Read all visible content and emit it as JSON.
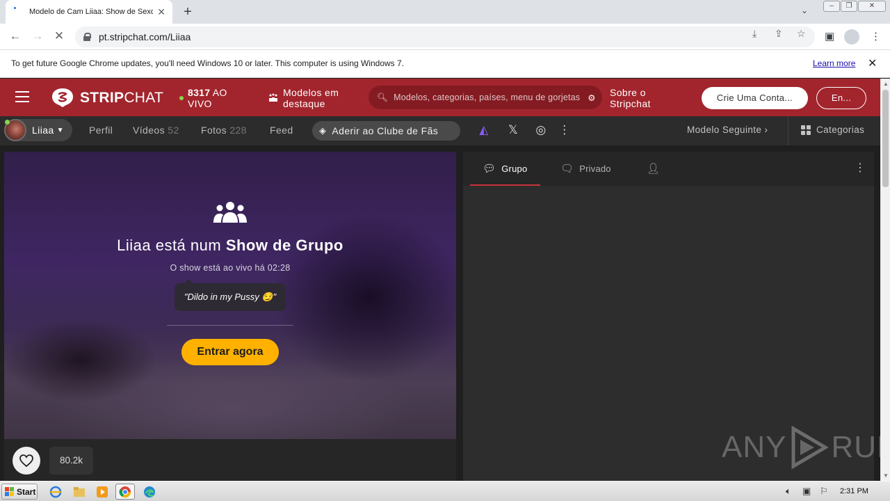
{
  "browser": {
    "tab_title": "Modelo de Cam Liiaa: Show de Sexo",
    "new_tab_label": "+",
    "url": "pt.stripchat.com/Liiaa",
    "infobar": {
      "message": "To get future Google Chrome updates, you'll need Windows 10 or later. This computer is using Windows 7.",
      "link": "Learn more"
    }
  },
  "header": {
    "logo_bold": "STRIP",
    "logo_rest": "CHAT",
    "live_count": "8317",
    "live_label": "AO VIVO",
    "featured_line1": "Modelos em",
    "featured_line2": "destaque",
    "search_placeholder": "Modelos, categorias, países, menu de gorjetas",
    "about_line1": "Sobre o",
    "about_line2": "Stripchat",
    "signup": "Crie Uma Conta...",
    "login": "En..."
  },
  "model_nav": {
    "model_name": "Liiaa",
    "profile": "Perfil",
    "videos": "Vídeos",
    "videos_count": "52",
    "photos": "Fotos",
    "photos_count": "228",
    "feed": "Feed",
    "fan_club": "Aderir ao Clube de Fãs",
    "next_model": "Modelo Seguinte",
    "categories": "Categorias"
  },
  "player": {
    "title_pre": "Liiaa está num ",
    "title_bold": "Show de Grupo",
    "live_time": "O show está ao vivo há 02:28",
    "topic": "\"Dildo in my Pussy 😏\"",
    "enter_button": "Entrar agora",
    "favorites": "80.2k"
  },
  "chat": {
    "tab_group": "Grupo",
    "tab_private": "Privado"
  },
  "watermark": {
    "left": "ANY",
    "right": "RUN"
  },
  "taskbar": {
    "start": "Start",
    "clock": "2:31 PM"
  },
  "colors": {
    "brand_red": "#a2252d",
    "accent_yellow": "#ffb100",
    "live_green": "#8bd44d"
  }
}
